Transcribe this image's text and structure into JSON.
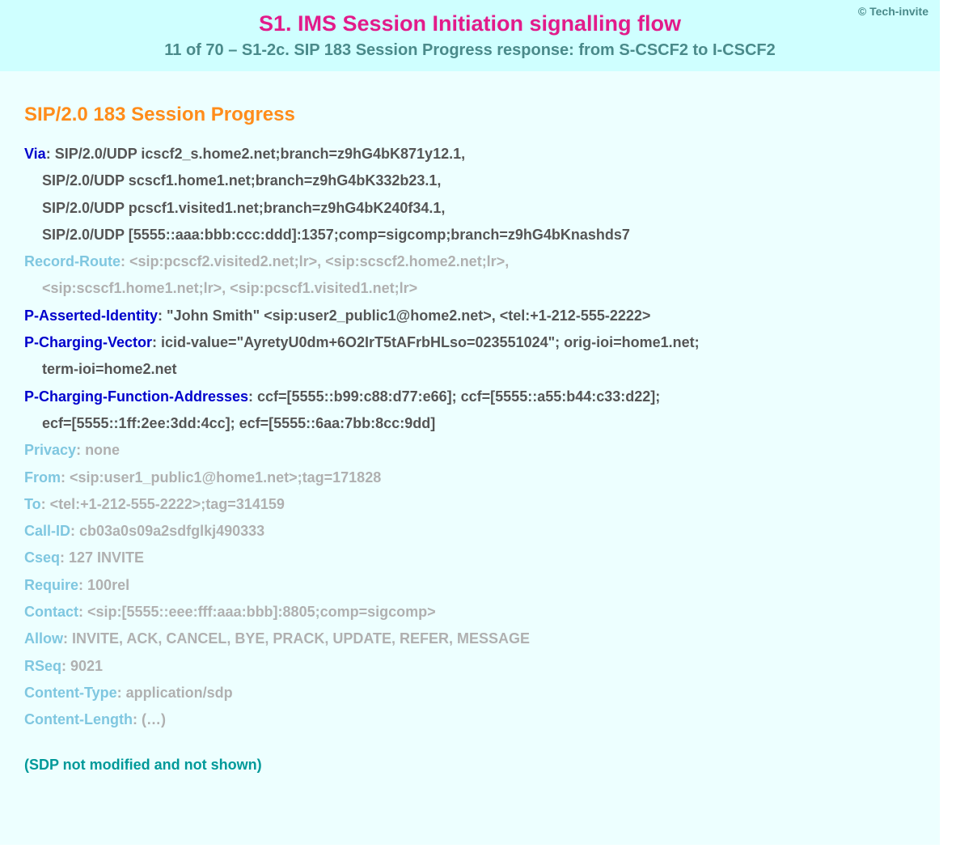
{
  "copyright": "© Tech-invite",
  "header": {
    "title": "S1. IMS Session Initiation signalling flow",
    "subtitle": "11 of 70 – S1-2c. SIP 183 Session Progress response: from S-CSCF2 to I-CSCF2"
  },
  "status_line": "SIP/2.0 183 Session Progress",
  "via": {
    "label": "Via",
    "lines": [
      "SIP/2.0/UDP icscf2_s.home2.net;branch=z9hG4bK871y12.1,",
      "SIP/2.0/UDP scscf1.home1.net;branch=z9hG4bK332b23.1,",
      "SIP/2.0/UDP pcscf1.visited1.net;branch=z9hG4bK240f34.1,",
      "SIP/2.0/UDP [5555::aaa:bbb:ccc:ddd]:1357;comp=sigcomp;branch=z9hG4bKnashds7"
    ]
  },
  "record_route": {
    "label": "Record-Route",
    "lines": [
      "<sip:pcscf2.visited2.net;lr>, <sip:scscf2.home2.net;lr>,",
      "<sip:scscf1.home1.net;lr>, <sip:pcscf1.visited1.net;lr>"
    ]
  },
  "p_asserted_identity": {
    "label": "P-Asserted-Identity",
    "value": "\"John Smith\" <sip:user2_public1@home2.net>, <tel:+1-212-555-2222>"
  },
  "p_charging_vector": {
    "label": "P-Charging-Vector",
    "lines": [
      "icid-value=\"AyretyU0dm+6O2IrT5tAFrbHLso=023551024\"; orig-ioi=home1.net;",
      "term-ioi=home2.net"
    ]
  },
  "p_charging_function_addresses": {
    "label": "P-Charging-Function-Addresses",
    "lines": [
      "ccf=[5555::b99:c88:d77:e66]; ccf=[5555::a55:b44:c33:d22];",
      "ecf=[5555::1ff:2ee:3dd:4cc]; ecf=[5555::6aa:7bb:8cc:9dd]"
    ]
  },
  "privacy": {
    "label": "Privacy",
    "value": "none"
  },
  "from": {
    "label": "From",
    "value": "<sip:user1_public1@home1.net>;tag=171828"
  },
  "to": {
    "label": "To",
    "value": "<tel:+1-212-555-2222>;tag=314159"
  },
  "call_id": {
    "label": "Call-ID",
    "value": "cb03a0s09a2sdfglkj490333"
  },
  "cseq": {
    "label": "Cseq",
    "value": "127 INVITE"
  },
  "require": {
    "label": "Require",
    "value": "100rel"
  },
  "contact": {
    "label": "Contact",
    "value": "<sip:[5555::eee:fff:aaa:bbb]:8805;comp=sigcomp>"
  },
  "allow": {
    "label": "Allow",
    "value": "INVITE, ACK, CANCEL, BYE, PRACK, UPDATE, REFER, MESSAGE"
  },
  "rseq": {
    "label": "RSeq",
    "value": "9021"
  },
  "content_type": {
    "label": "Content-Type",
    "value": "application/sdp"
  },
  "content_length": {
    "label": "Content-Length",
    "value": "(…)"
  },
  "note": "(SDP not modified and not shown)"
}
